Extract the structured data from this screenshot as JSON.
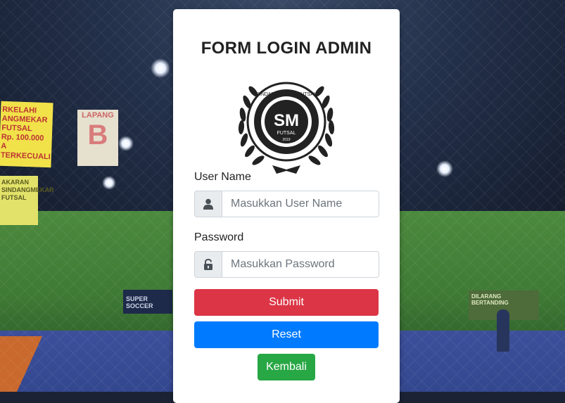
{
  "background": {
    "banners": {
      "yellow_text": "RKELAHI\nANGMEKAR FUTSAL\nRp. 100.000\nA TERKECUALI",
      "yellow2_text": "AKARAN\nSINDANGMEKAR FUTSAL",
      "lapang_label": "LAPANG",
      "lapang_letter": "B",
      "dark_text": "SUPER SOCCER",
      "right_text": "DILARANG BERTANDING"
    }
  },
  "form": {
    "title": "FORM LOGIN ADMIN",
    "logo": {
      "ring_text": "SINDANGMEKAR FUTSAL",
      "initials": "SM",
      "subtitle": "FUTSAL",
      "year": "2019"
    },
    "username": {
      "label": "User Name",
      "placeholder": "Masukkan User Name",
      "value": "",
      "icon": "user-icon"
    },
    "password": {
      "label": "Password",
      "placeholder": "Masukkan Password",
      "value": "",
      "icon": "unlock-icon"
    },
    "buttons": {
      "submit": "Submit",
      "reset": "Reset",
      "back": "Kembali"
    }
  },
  "colors": {
    "submit": "#dc3545",
    "reset": "#007bff",
    "back": "#28a745"
  }
}
